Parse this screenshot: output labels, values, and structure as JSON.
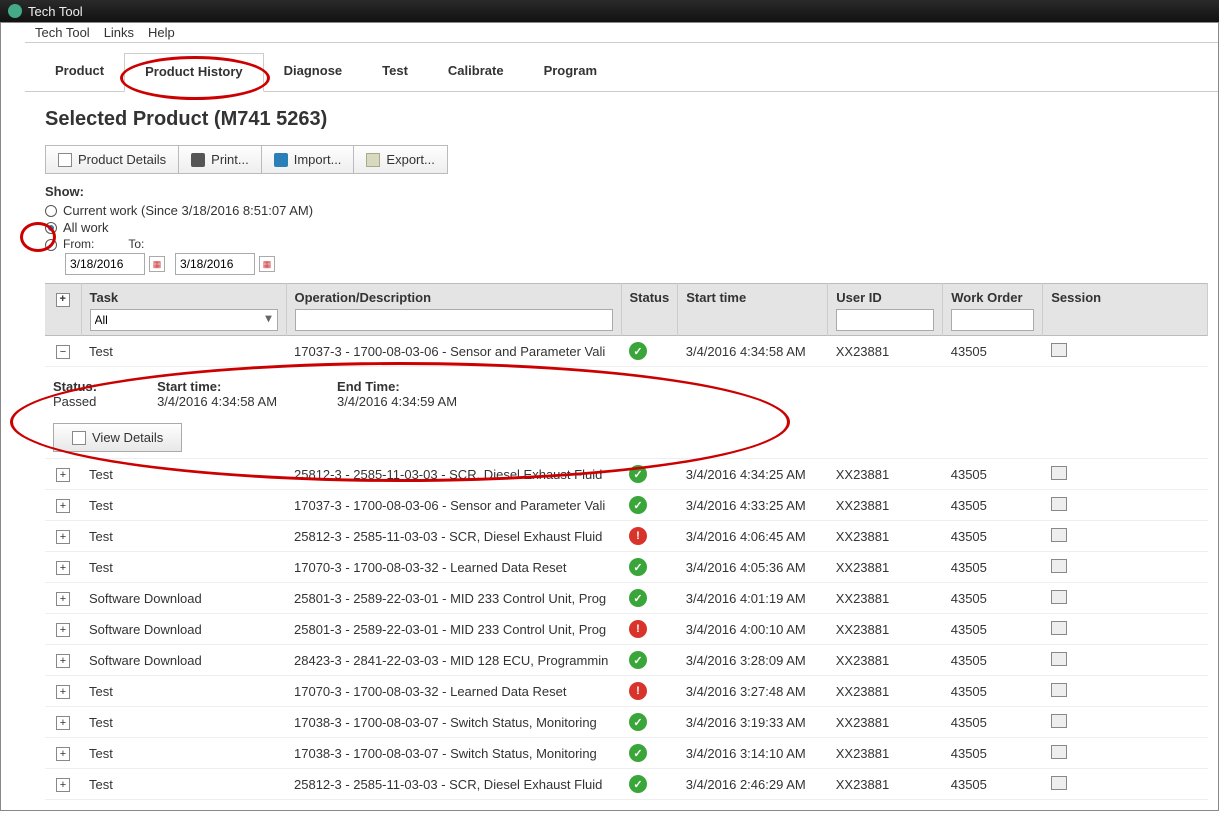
{
  "window": {
    "title": "Tech Tool"
  },
  "menubar": {
    "items": [
      "Tech Tool",
      "Links",
      "Help"
    ]
  },
  "tabs": [
    "Product",
    "Product History",
    "Diagnose",
    "Test",
    "Calibrate",
    "Program"
  ],
  "active_tab_index": 1,
  "page_title": "Selected Product (M741 5263)",
  "toolbar": {
    "product_details": "Product Details",
    "print": "Print...",
    "import": "Import...",
    "export": "Export..."
  },
  "show": {
    "label": "Show:",
    "opt_current": "Current work (Since 3/18/2016 8:51:07 AM)",
    "opt_all": "All work",
    "opt_from": "From:",
    "to_label": "To:",
    "selected": "all",
    "date_from": "3/18/2016",
    "date_to": "3/18/2016"
  },
  "columns": {
    "task": "Task",
    "operation": "Operation/Description",
    "status": "Status",
    "start": "Start time",
    "user": "User ID",
    "wo": "Work Order",
    "session": "Session"
  },
  "filter_task_value": "All",
  "expanded_detail": {
    "status_label": "Status:",
    "status_value": "Passed",
    "start_label": "Start time:",
    "start_value": "3/4/2016 4:34:58 AM",
    "end_label": "End Time:",
    "end_value": "3/4/2016 4:34:59 AM",
    "view_details": "View Details"
  },
  "rows": [
    {
      "expanded": true,
      "task": "Test",
      "op": "17037-3 - 1700-08-03-06 - Sensor and Parameter Vali",
      "status": "green",
      "start": "3/4/2016 4:34:58 AM",
      "user": "XX23881",
      "wo": "43505"
    },
    {
      "expanded": false,
      "task": "Test",
      "op": "25812-3 - 2585-11-03-03 - SCR, Diesel Exhaust Fluid",
      "status": "green",
      "start": "3/4/2016 4:34:25 AM",
      "user": "XX23881",
      "wo": "43505"
    },
    {
      "expanded": false,
      "task": "Test",
      "op": "17037-3 - 1700-08-03-06 - Sensor and Parameter Vali",
      "status": "green",
      "start": "3/4/2016 4:33:25 AM",
      "user": "XX23881",
      "wo": "43505"
    },
    {
      "expanded": false,
      "task": "Test",
      "op": "25812-3 - 2585-11-03-03 - SCR, Diesel Exhaust Fluid",
      "status": "red",
      "start": "3/4/2016 4:06:45 AM",
      "user": "XX23881",
      "wo": "43505"
    },
    {
      "expanded": false,
      "task": "Test",
      "op": "17070-3 - 1700-08-03-32 - Learned Data Reset",
      "status": "green",
      "start": "3/4/2016 4:05:36 AM",
      "user": "XX23881",
      "wo": "43505"
    },
    {
      "expanded": false,
      "task": "Software Download",
      "op": "25801-3 - 2589-22-03-01 - MID 233 Control Unit, Prog",
      "status": "green",
      "start": "3/4/2016 4:01:19 AM",
      "user": "XX23881",
      "wo": "43505"
    },
    {
      "expanded": false,
      "task": "Software Download",
      "op": "25801-3 - 2589-22-03-01 - MID 233 Control Unit, Prog",
      "status": "red",
      "start": "3/4/2016 4:00:10 AM",
      "user": "XX23881",
      "wo": "43505"
    },
    {
      "expanded": false,
      "task": "Software Download",
      "op": "28423-3 - 2841-22-03-03 - MID 128 ECU, Programmin",
      "status": "green",
      "start": "3/4/2016 3:28:09 AM",
      "user": "XX23881",
      "wo": "43505"
    },
    {
      "expanded": false,
      "task": "Test",
      "op": "17070-3 - 1700-08-03-32 - Learned Data Reset",
      "status": "red",
      "start": "3/4/2016 3:27:48 AM",
      "user": "XX23881",
      "wo": "43505"
    },
    {
      "expanded": false,
      "task": "Test",
      "op": "17038-3 - 1700-08-03-07 - Switch Status, Monitoring",
      "status": "green",
      "start": "3/4/2016 3:19:33 AM",
      "user": "XX23881",
      "wo": "43505"
    },
    {
      "expanded": false,
      "task": "Test",
      "op": "17038-3 - 1700-08-03-07 - Switch Status, Monitoring",
      "status": "green",
      "start": "3/4/2016 3:14:10 AM",
      "user": "XX23881",
      "wo": "43505"
    },
    {
      "expanded": false,
      "task": "Test",
      "op": "25812-3 - 2585-11-03-03 - SCR, Diesel Exhaust Fluid",
      "status": "green",
      "start": "3/4/2016 2:46:29 AM",
      "user": "XX23881",
      "wo": "43505"
    }
  ]
}
